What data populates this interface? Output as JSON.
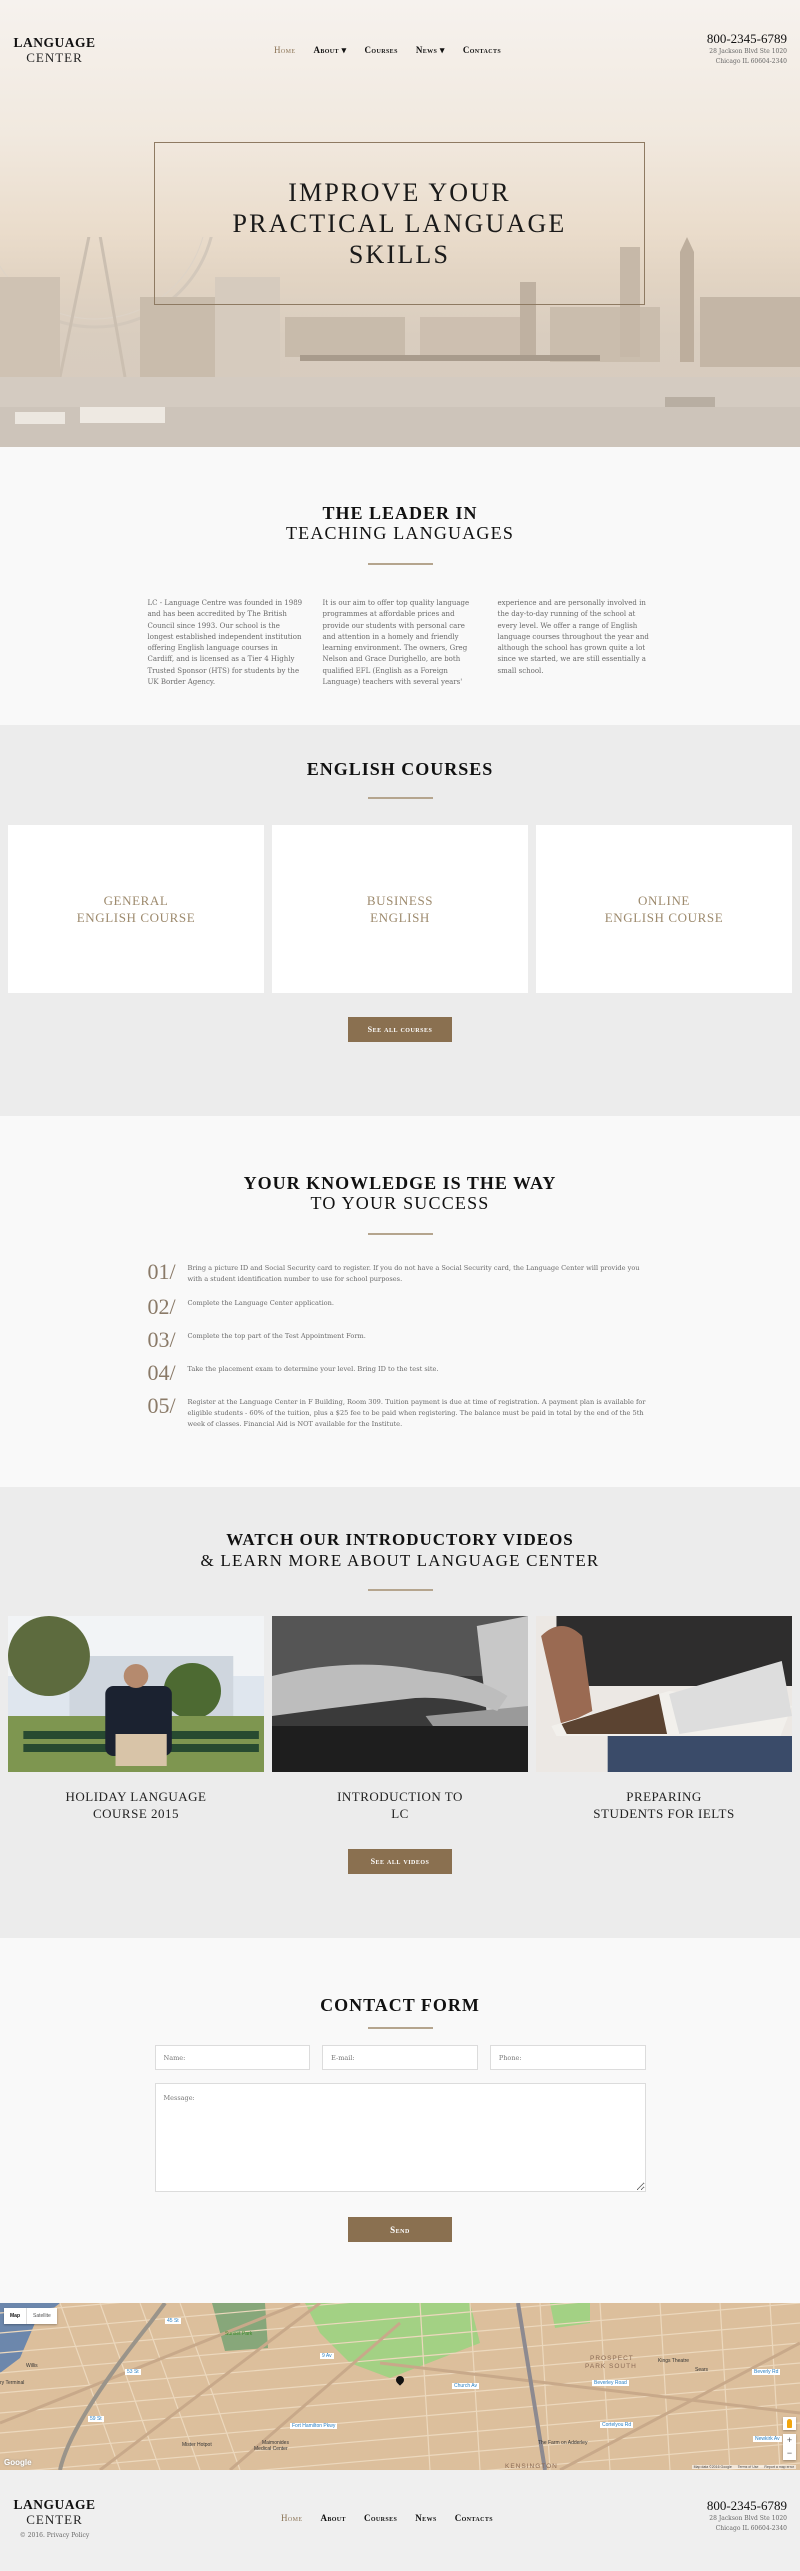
{
  "header": {
    "logo_top": "LANGUAGE",
    "logo_bottom": "CENTER",
    "nav": [
      {
        "label": "Home",
        "active": true,
        "dropdown": false
      },
      {
        "label": "About ▾",
        "active": false,
        "dropdown": true
      },
      {
        "label": "Courses",
        "active": false,
        "dropdown": false
      },
      {
        "label": "News ▾",
        "active": false,
        "dropdown": true
      },
      {
        "label": "Contacts",
        "active": false,
        "dropdown": false
      }
    ],
    "phone": "800-2345-6789",
    "address_line1": "28 Jackson Blvd Ste 1020",
    "address_line2": "Chicago IL 60604-2340"
  },
  "hero": {
    "title_line1": "IMPROVE YOUR",
    "title_line2": "PRACTICAL LANGUAGE",
    "title_line3": "SKILLS"
  },
  "leader": {
    "title_bold": "THE LEADER IN",
    "title_light": "TEACHING LANGUAGES",
    "columns": [
      "LC - Language Centre was founded in 1989 and has been accredited by The British Council since 1993. Our school is the longest established independent institution offering English language courses in Cardiff, and is licensed as a Tier 4 Highly Trusted Sponsor (HTS) for students by the UK Border Agency.",
      "It is our aim to offer top quality language programmes at affordable prices and provide our students with personal care and attention in a homely and friendly learning environment. The owners, Greg Nelson and Grace Durighello, are both qualified EFL (English as a Foreign Language) teachers with several years'",
      "experience and are personally involved in the day-to-day running of the school at every level. We offer a range of English language courses throughout the year and although the school has grown quite a lot since we started, we are still essentially a small school."
    ]
  },
  "courses": {
    "title": "ENGLISH COURSES",
    "items": [
      {
        "line1": "GENERAL",
        "line2": "ENGLISH COURSE"
      },
      {
        "line1": "BUSINESS",
        "line2": "ENGLISH"
      },
      {
        "line1": "ONLINE",
        "line2": "ENGLISH COURSE"
      }
    ],
    "button": "See all courses"
  },
  "steps": {
    "title_bold": "YOUR KNOWLEDGE IS THE WAY",
    "title_light": "TO YOUR SUCCESS",
    "items": [
      {
        "num": "01/",
        "text": "Bring a picture ID and Social Security card to register. If you do not have a Social Security card, the Language Center will provide you with a student identification number to use for school purposes."
      },
      {
        "num": "02/",
        "text": "Complete the Language Center application."
      },
      {
        "num": "03/",
        "text": "Complete the top part of the Test Appointment Form."
      },
      {
        "num": "04/",
        "text": "Take the placement exam to determine your level. Bring ID to the test site."
      },
      {
        "num": "05/",
        "text": "Register at the Language Center in F Building, Room 309. Tuition payment is due at time of registration. A payment plan is available for eligible students - 60% of the tuition, plus a $25 fee to be paid when registering. The balance must be paid in total by the end of the 5th week of classes. Financial Aid is NOT available for the Institute."
      }
    ]
  },
  "videos": {
    "title_bold": "WATCH OUR INTRODUCTORY VIDEOS",
    "title_light": "& LEARN MORE ABOUT LANGUAGE CENTER",
    "items": [
      {
        "line1": "HOLIDAY LANGUAGE",
        "line2": "COURSE 2015",
        "thumb": "man-with-laptop-on-bench"
      },
      {
        "line1": "INTRODUCTION TO",
        "line2": "LC",
        "thumb": "hands-typing-on-laptop"
      },
      {
        "line1": "PREPARING",
        "line2": "STUDENTS FOR IELTS",
        "thumb": "person-reading-book"
      }
    ],
    "button": "See all videos"
  },
  "contact_form": {
    "title": "CONTACT FORM",
    "name_placeholder": "Name:",
    "email_placeholder": "E-mail:",
    "phone_placeholder": "Phone:",
    "message_placeholder": "Message:",
    "button": "Send"
  },
  "map": {
    "type_map": "Map",
    "type_satellite": "Satellite",
    "labels": {
      "area1": "PROSPECT",
      "area2": "PARK SOUTH",
      "area3": "KENSINGTON",
      "place1": "Willis",
      "place2": "ry Terminal",
      "place3": "Sunset Park",
      "place4": "Mister Hotpot",
      "place5": "Maimonides",
      "place6": "Medical Center",
      "place7": "Kings Theatre",
      "place8": "Sears",
      "place9": "The Farm on Adderley",
      "metro1": "45 St",
      "metro2": "53 St",
      "metro3": "59 St",
      "metro4": "9 Av",
      "metro5": "Fort Hamilton Pkwy",
      "metro6": "Church Av",
      "metro7": "Beverley Road",
      "metro8": "Cortelyou Rd",
      "metro9": "Beverly Rd",
      "metro10": "Newkirk Av"
    },
    "zoom_in": "+",
    "zoom_out": "−",
    "google": "Google",
    "attribution": "Map data ©2016 Google",
    "terms": "Terms of Use",
    "report": "Report a map error"
  },
  "footer": {
    "logo_top": "LANGUAGE",
    "logo_bottom": "CENTER",
    "copyright": "© 2016. Privacy Policy",
    "nav": [
      {
        "label": "Home",
        "active": true
      },
      {
        "label": "About",
        "active": false
      },
      {
        "label": "Courses",
        "active": false
      },
      {
        "label": "News",
        "active": false
      },
      {
        "label": "Contacts",
        "active": false
      }
    ],
    "phone": "800-2345-6789",
    "address_line1": "28 Jackson Blvd Ste 1020",
    "address_line2": "Chicago IL 60604-2340"
  },
  "colors": {
    "accent": "#8a7050",
    "accent_text": "#9d8a6d",
    "divider": "#b5a58e",
    "section_gray": "#ececec",
    "section_white": "#f9f9f9"
  }
}
